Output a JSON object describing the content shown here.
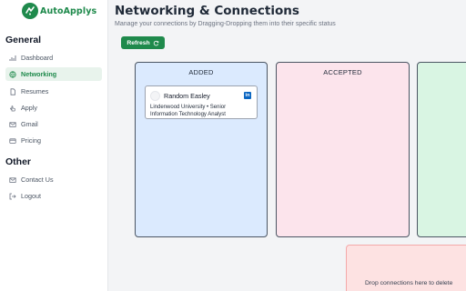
{
  "app": {
    "name": "AutoApplys",
    "brand_color": "#1f8a4c"
  },
  "sidebar": {
    "general_title": "General",
    "general_items": [
      {
        "label": "Dashboard",
        "icon": "bar-chart-icon",
        "active": false
      },
      {
        "label": "Networking",
        "icon": "globe-icon",
        "active": true
      },
      {
        "label": "Resumes",
        "icon": "document-icon",
        "active": false
      },
      {
        "label": "Apply",
        "icon": "hand-pointer-icon",
        "active": false
      },
      {
        "label": "Gmail",
        "icon": "mail-icon",
        "active": false
      },
      {
        "label": "Pricing",
        "icon": "credit-card-icon",
        "active": false
      }
    ],
    "other_title": "Other",
    "other_items": [
      {
        "label": "Contact Us",
        "icon": "mail-icon"
      },
      {
        "label": "Logout",
        "icon": "logout-icon"
      }
    ]
  },
  "main": {
    "title": "Networking & Connections",
    "subtitle": "Manage your connections by Dragging-Dropping them into their specific status",
    "refresh_label": "Refresh",
    "columns": [
      {
        "title": "ADDED",
        "color": "#dbeafe"
      },
      {
        "title": "ACCEPTED",
        "color": "#fce4ec"
      },
      {
        "title": "",
        "color": "#d9f5e3"
      }
    ],
    "cards": [
      {
        "name": "Random Easley",
        "detail": "Lindenwood University • Senior Information Technology Analyst",
        "link_icon": "linkedin-icon"
      }
    ],
    "delete_zone_text": "Drop connections here to delete"
  }
}
